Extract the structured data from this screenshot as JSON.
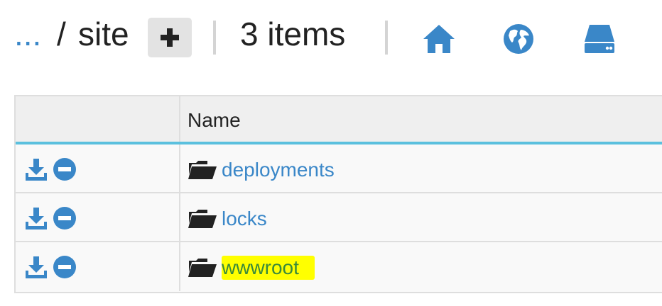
{
  "breadcrumb": {
    "ellipsis": "...",
    "separator": "/",
    "current": "site"
  },
  "header": {
    "add_label": "+",
    "item_count": "3 items"
  },
  "toolbar": {
    "icons": [
      "home-icon",
      "globe-icon",
      "drive-icon"
    ],
    "accent": "#3a87c8"
  },
  "table": {
    "columns": [
      "",
      "Name"
    ],
    "rows": [
      {
        "name": "deployments",
        "type": "folder",
        "highlighted": false
      },
      {
        "name": "locks",
        "type": "folder",
        "highlighted": false
      },
      {
        "name": "wwwroot",
        "type": "folder",
        "highlighted": true
      }
    ]
  },
  "colors": {
    "link": "#3a87c8",
    "highlight": "#ffff00",
    "header_rule": "#5bc0de"
  }
}
